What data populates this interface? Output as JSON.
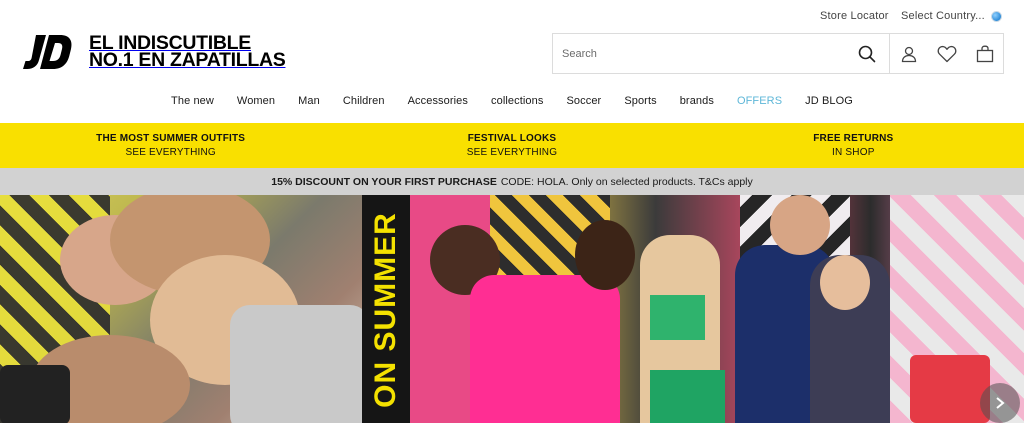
{
  "topbar": {
    "store_locator": "Store Locator",
    "select_country": "Select Country..."
  },
  "logo": {
    "mark": "JD",
    "line1": "EL INDISCUTIBLE",
    "line2": "No.1 EN ZAPATILLAS"
  },
  "search": {
    "placeholder": "Search"
  },
  "icons": {
    "search": "search-icon",
    "account": "user-icon",
    "wishlist": "heart-icon",
    "bag": "bag-icon",
    "globe": "globe-icon"
  },
  "nav": {
    "items": [
      {
        "label": "The new"
      },
      {
        "label": "Women"
      },
      {
        "label": "Man"
      },
      {
        "label": "Children"
      },
      {
        "label": "Accessories"
      },
      {
        "label": "collections"
      },
      {
        "label": "Soccer"
      },
      {
        "label": "Sports"
      },
      {
        "label": "brands"
      },
      {
        "label": "OFFERS"
      },
      {
        "label": "JD BLOG"
      }
    ]
  },
  "promo": {
    "items": [
      {
        "title": "THE MOST SUMMER OUTFITS",
        "sub": "SEE EVERYTHING"
      },
      {
        "title": "FESTIVAL LOOKS",
        "sub": "SEE EVERYTHING"
      },
      {
        "title": "FREE RETURNS",
        "sub": "IN SHOP"
      }
    ]
  },
  "discount": {
    "bold": "15% DISCOUNT ON YOUR FIRST PURCHASE",
    "rest": "CODE: HOLA. Only on selected products. T&Cs apply"
  },
  "hero": {
    "strip_text": "ON SUMMER"
  },
  "colors": {
    "promo_bg": "#f9e000",
    "discount_bg": "#d2d2d2",
    "offers_link": "#5eb7d8"
  }
}
